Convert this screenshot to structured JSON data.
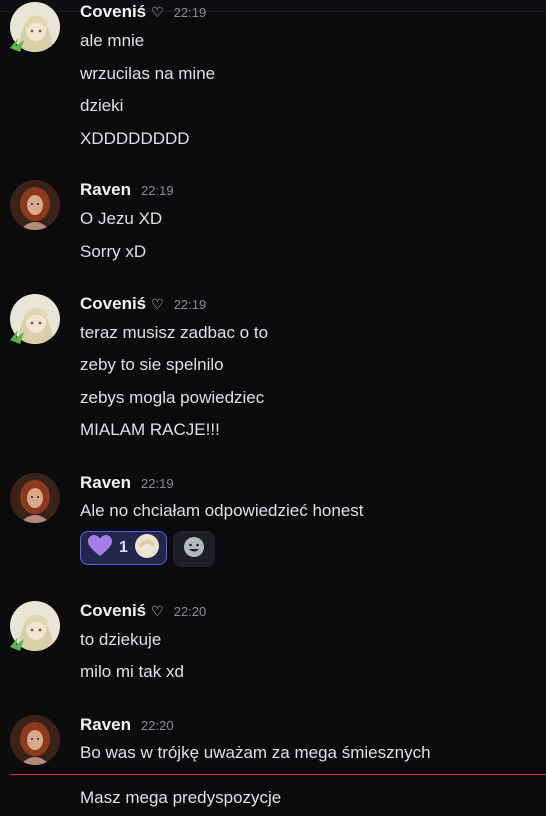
{
  "colors": {
    "background": "#0b0b0e",
    "username": "#f2f3f5",
    "timestamp": "#8a8c94",
    "reaction_border": "#5865f2",
    "new_message_divider": "#d2353b"
  },
  "messages": [
    {
      "author": "Coveniś",
      "badge": "♡",
      "time": "22:19",
      "avatar": "anime-avatar-icon",
      "lines": [
        "ale mnie",
        "wrzucilas na mine",
        "dzieki",
        "XDDDDDDDD"
      ]
    },
    {
      "author": "Raven",
      "time": "22:19",
      "avatar": "redhead-avatar-icon",
      "lines": [
        "O Jezu XD",
        "Sorry xD"
      ]
    },
    {
      "author": "Coveniś",
      "badge": "♡",
      "time": "22:19",
      "avatar": "anime-avatar-icon",
      "lines": [
        "teraz musisz zadbac o to",
        "zeby to sie spelnilo",
        "zebys mogla powiedziec",
        "MIALAM RACJE!!!"
      ]
    },
    {
      "author": "Raven",
      "time": "22:19",
      "avatar": "redhead-avatar-icon",
      "lines": [
        "Ale no chciałam odpowiedzieć honest"
      ],
      "reaction": {
        "emoji": "purple-heart-icon",
        "count": "1"
      }
    },
    {
      "author": "Coveniś",
      "badge": "♡",
      "time": "22:20",
      "avatar": "anime-avatar-icon",
      "lines": [
        "to dziekuje",
        "milo mi tak xd"
      ]
    },
    {
      "author": "Raven",
      "time": "22:20",
      "avatar": "redhead-avatar-icon",
      "lines": [
        "Bo was w trójkę uważam za mega śmiesznych",
        "Masz mega predyspozycje"
      ]
    }
  ]
}
